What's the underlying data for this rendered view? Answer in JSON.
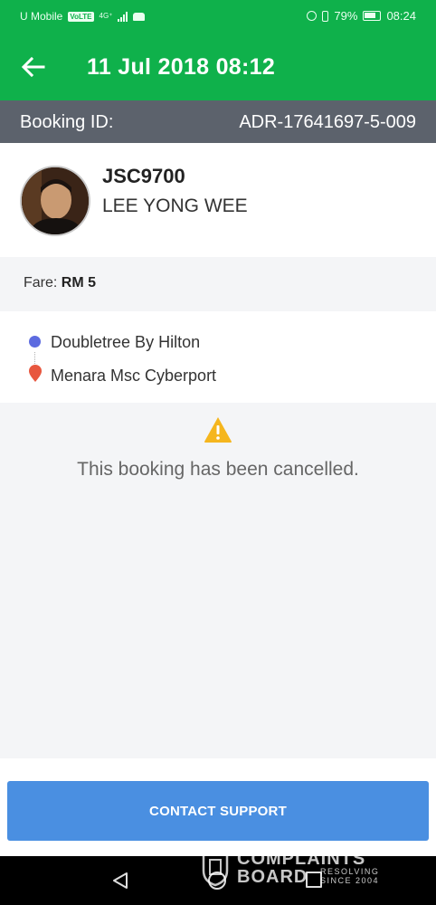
{
  "status_bar": {
    "carrier": "U Mobile",
    "volte": "VoLTE",
    "network": "4G⁺",
    "battery": "79%",
    "time": "08:24"
  },
  "app_bar": {
    "title": "11 Jul 2018 08:12"
  },
  "booking": {
    "label": "Booking ID:",
    "value": "ADR-17641697-5-009"
  },
  "driver": {
    "plate": "JSC9700",
    "name": "LEE YONG WEE"
  },
  "fare": {
    "label": "Fare:",
    "value": "RM 5"
  },
  "route": {
    "pickup": "Doubletree By Hilton",
    "dropoff": "Menara Msc Cyberport",
    "pickup_color": "#5d6be0",
    "dropoff_color": "#e8573f"
  },
  "cancellation": {
    "message": "This booking has been cancelled.",
    "icon": "warning-icon",
    "icon_color": "#f5b61e"
  },
  "actions": {
    "contact_support": "CONTACT SUPPORT"
  },
  "watermark": {
    "line1": "COMPLAINTS",
    "line2": "BOARD",
    "side1": "RESOLVING",
    "side2": "SINCE 2004"
  },
  "colors": {
    "brand": "#0fb14b",
    "booking_bar": "#5c626c",
    "button": "#4a8fe1"
  }
}
